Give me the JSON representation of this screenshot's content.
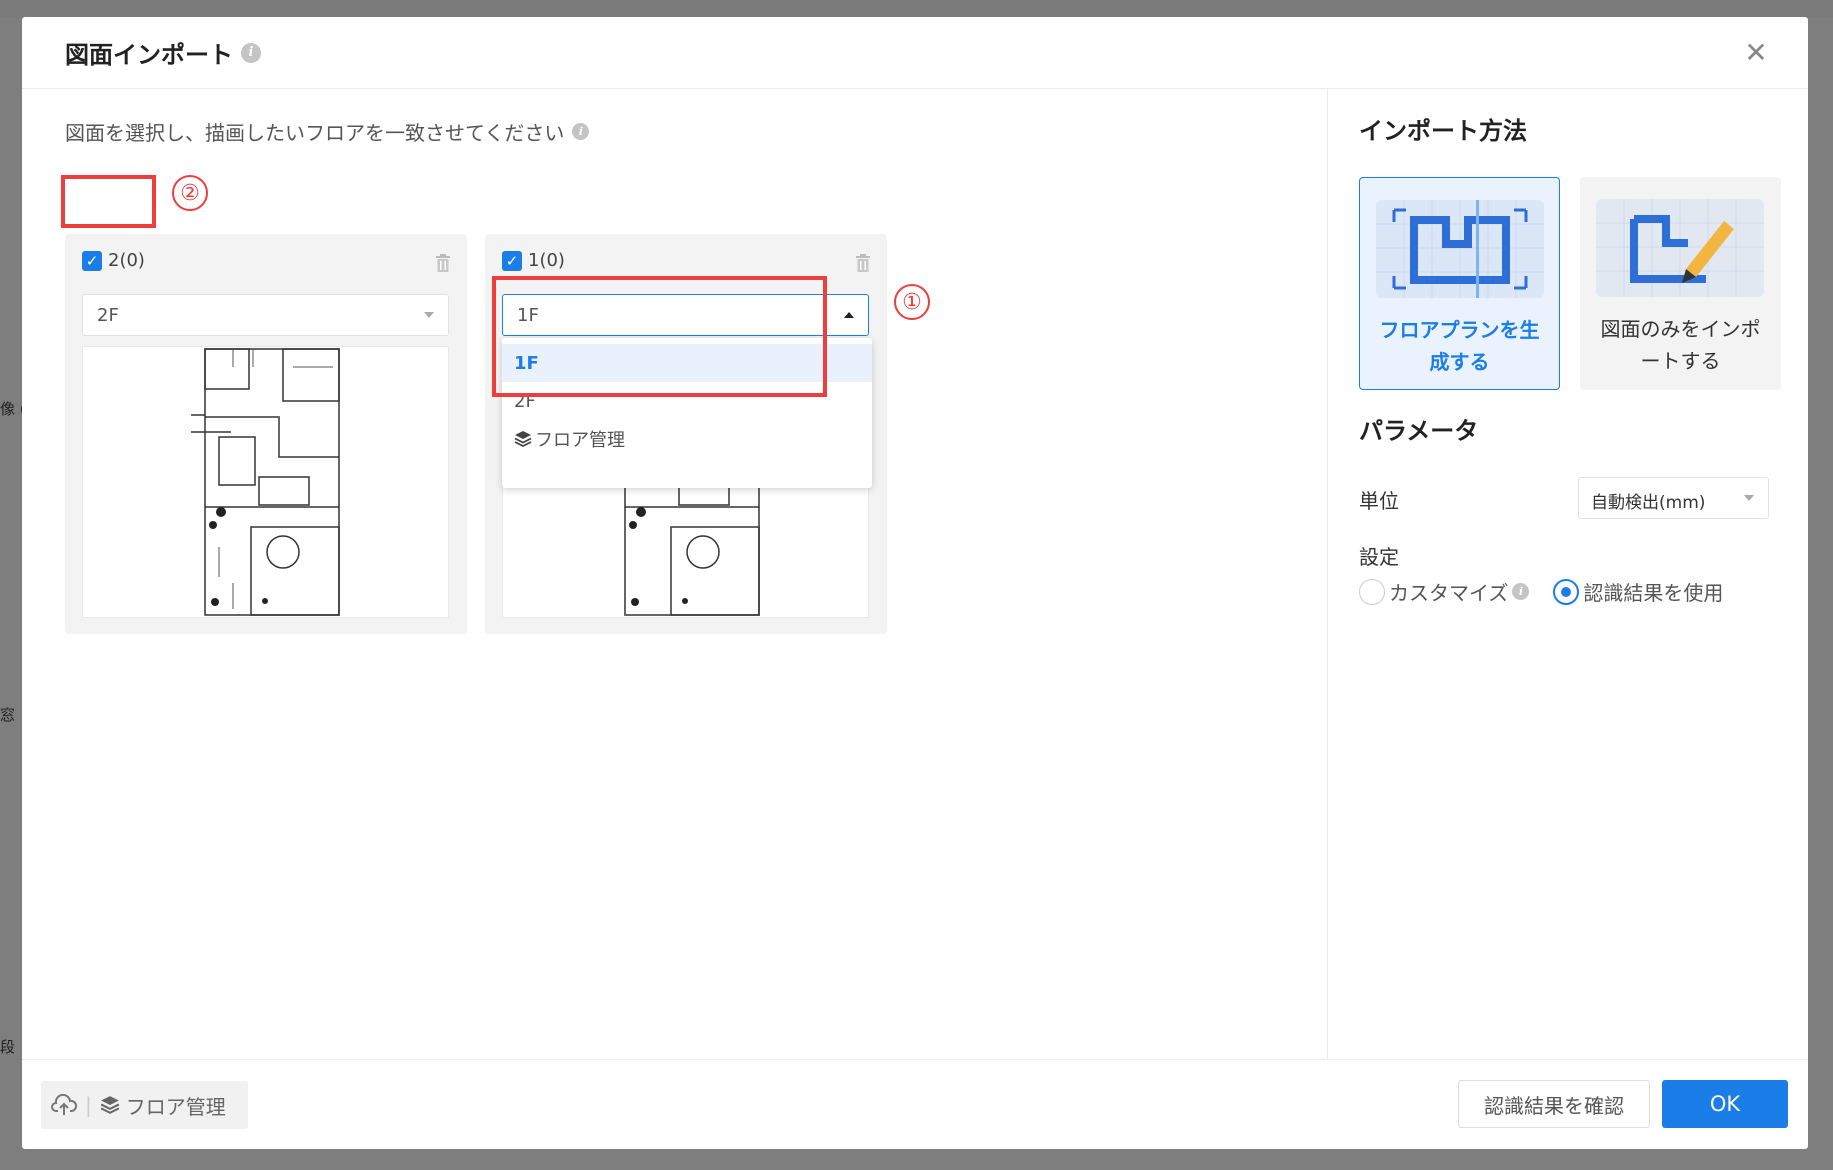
{
  "dialog": {
    "title": "図面インポート",
    "instruction": "図面を選択し、描画したいフロアを一致させてください"
  },
  "cards": [
    {
      "label": "2(0)",
      "checked": true,
      "selected_floor": "2F"
    },
    {
      "label": "1(0)",
      "checked": true,
      "selected_floor": "1F"
    }
  ],
  "dropdown": {
    "options": [
      "1F",
      "2F",
      "フロア管理"
    ],
    "active": "1F"
  },
  "annotations": {
    "first": "①",
    "second": "②"
  },
  "right": {
    "import_method_title": "インポート方法",
    "methods": [
      {
        "label_line1": "フロアプランを生",
        "label_line2": "成する",
        "selected": true
      },
      {
        "label_line1": "図面のみをインポ",
        "label_line2": "ートする",
        "selected": false
      }
    ],
    "params_title": "パラメータ",
    "unit_label": "単位",
    "unit_value": "自動検出(mm)",
    "setting_label": "設定",
    "radio_custom": "カスタマイズ",
    "radio_use": "認識結果を使用"
  },
  "footer": {
    "floor_manage": "フロア管理",
    "confirm_label": "認識結果を確認",
    "ok_label": "OK"
  },
  "background": {
    "left_text_1": "像 (H",
    "left_text_2": "窓",
    "left_text_3": "段"
  },
  "colors": {
    "accent": "#1a7de8",
    "annotation_red": "#ee3d3d"
  }
}
